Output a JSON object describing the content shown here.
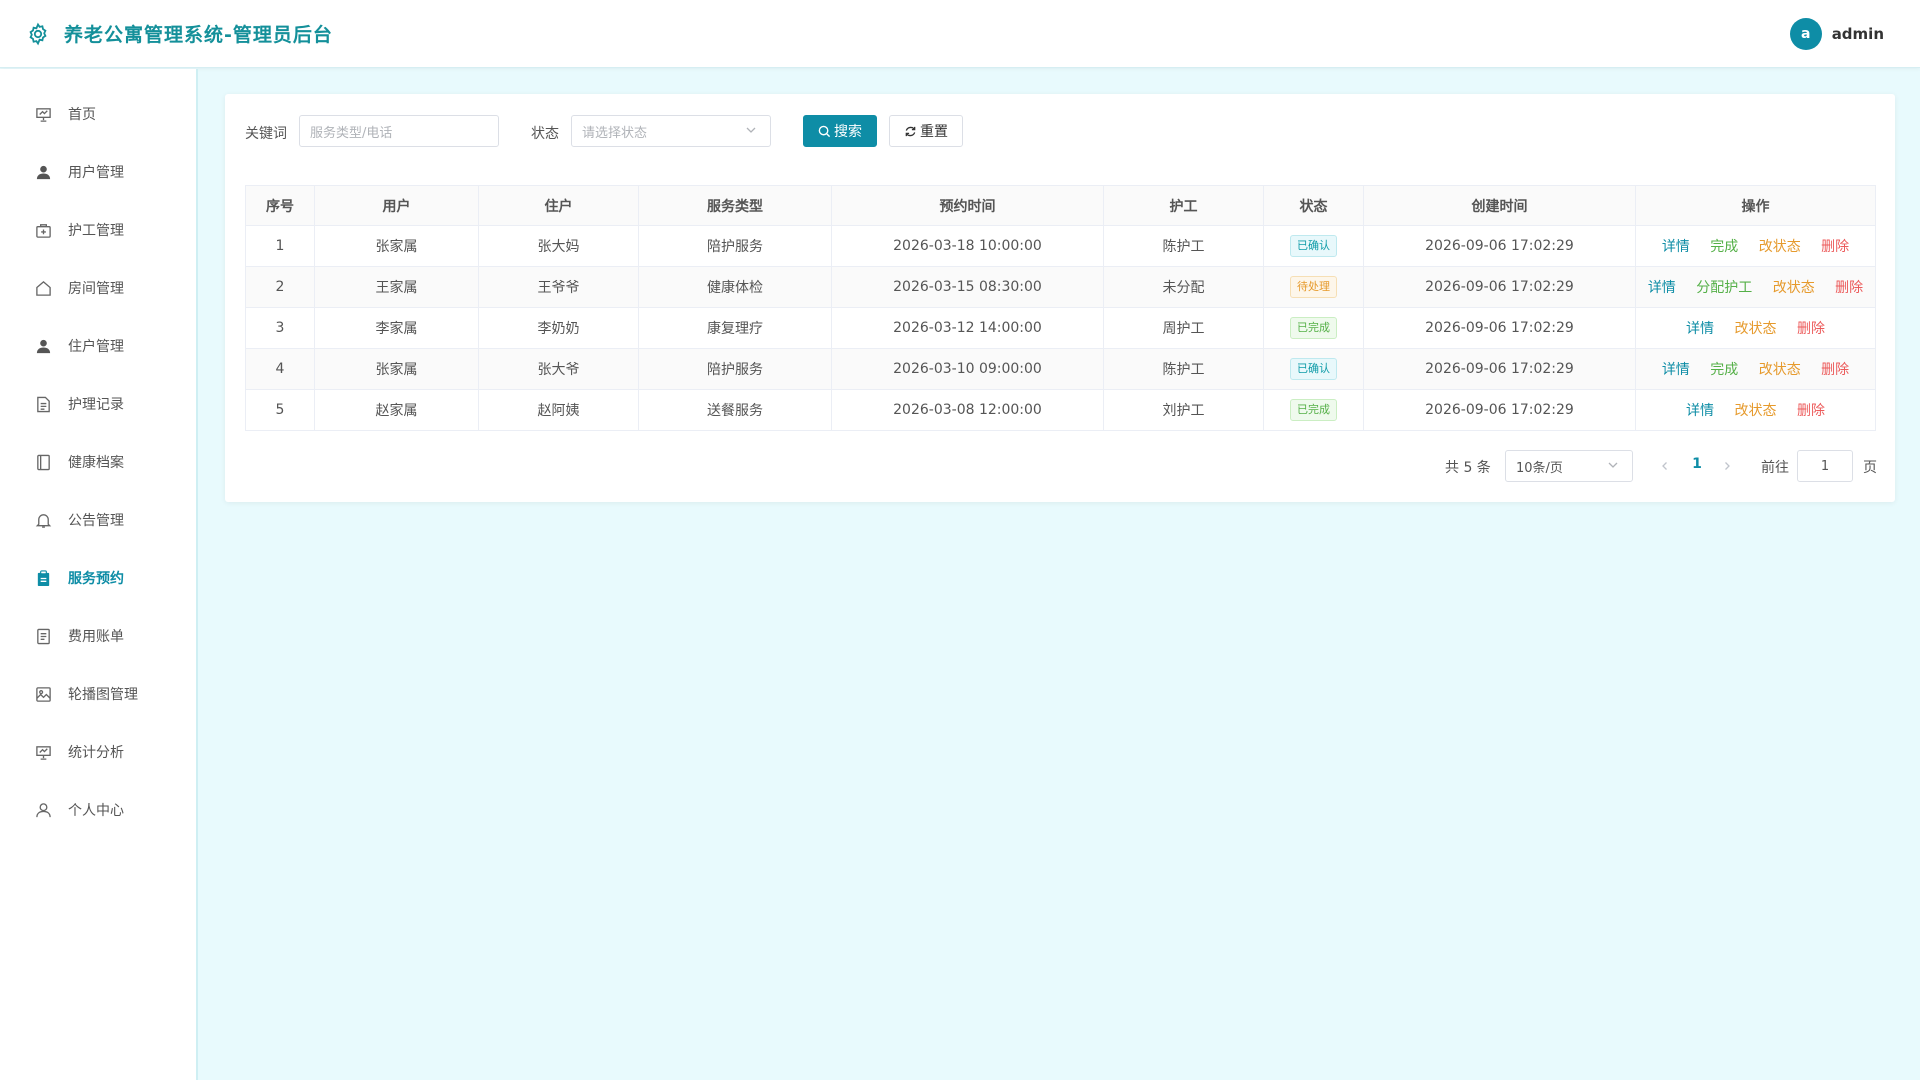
{
  "app": {
    "title": "养老公寓管理系统-管理员后台"
  },
  "user": {
    "avatar_letter": "a",
    "name": "admin"
  },
  "sidebar": {
    "items": [
      {
        "label": "首页",
        "icon": "presentation-icon",
        "active": false
      },
      {
        "label": "用户管理",
        "icon": "user-icon",
        "active": false
      },
      {
        "label": "护工管理",
        "icon": "first-aid-kit-icon",
        "active": false
      },
      {
        "label": "房间管理",
        "icon": "house-icon",
        "active": false
      },
      {
        "label": "住户管理",
        "icon": "user-icon",
        "active": false
      },
      {
        "label": "护理记录",
        "icon": "document-icon",
        "active": false
      },
      {
        "label": "健康档案",
        "icon": "notebook-icon",
        "active": false
      },
      {
        "label": "公告管理",
        "icon": "bell-icon",
        "active": false
      },
      {
        "label": "服务预约",
        "icon": "clipboard-icon",
        "active": true
      },
      {
        "label": "费用账单",
        "icon": "receipt-icon",
        "active": false
      },
      {
        "label": "轮播图管理",
        "icon": "picture-icon",
        "active": false
      },
      {
        "label": "统计分析",
        "icon": "data-board-icon",
        "active": false
      },
      {
        "label": "个人中心",
        "icon": "user-outline-icon",
        "active": false
      }
    ]
  },
  "filters": {
    "keyword_label": "关键词",
    "keyword_placeholder": "服务类型/电话",
    "status_label": "状态",
    "status_placeholder": "请选择状态",
    "search_label": "搜索",
    "reset_label": "重置"
  },
  "table": {
    "columns": [
      "序号",
      "用户",
      "住户",
      "服务类型",
      "预约时间",
      "护工",
      "状态",
      "创建时间",
      "操作"
    ],
    "rows": [
      {
        "index": "1",
        "user": "张家属",
        "resident": "张大妈",
        "service": "陪护服务",
        "appointment": "2026-03-18 10:00:00",
        "caregiver": "陈护工",
        "status": "已确认",
        "status_type": "confirm",
        "created": "2026-09-06 17:02:29",
        "actions": [
          "详情",
          "完成",
          "改状态",
          "删除"
        ]
      },
      {
        "index": "2",
        "user": "王家属",
        "resident": "王爷爷",
        "service": "健康体检",
        "appointment": "2026-03-15 08:30:00",
        "caregiver": "未分配",
        "status": "待处理",
        "status_type": "pending",
        "created": "2026-09-06 17:02:29",
        "actions": [
          "详情",
          "分配护工",
          "改状态",
          "删除"
        ]
      },
      {
        "index": "3",
        "user": "李家属",
        "resident": "李奶奶",
        "service": "康复理疗",
        "appointment": "2026-03-12 14:00:00",
        "caregiver": "周护工",
        "status": "已完成",
        "status_type": "done",
        "created": "2026-09-06 17:02:29",
        "actions": [
          "详情",
          "改状态",
          "删除"
        ]
      },
      {
        "index": "4",
        "user": "张家属",
        "resident": "张大爷",
        "service": "陪护服务",
        "appointment": "2026-03-10 09:00:00",
        "caregiver": "陈护工",
        "status": "已确认",
        "status_type": "confirm",
        "created": "2026-09-06 17:02:29",
        "actions": [
          "详情",
          "完成",
          "改状态",
          "删除"
        ]
      },
      {
        "index": "5",
        "user": "赵家属",
        "resident": "赵阿姨",
        "service": "送餐服务",
        "appointment": "2026-03-08 12:00:00",
        "caregiver": "刘护工",
        "status": "已完成",
        "status_type": "done",
        "created": "2026-09-06 17:02:29",
        "actions": [
          "详情",
          "改状态",
          "删除"
        ]
      }
    ]
  },
  "pagination": {
    "total_text": "共 5 条",
    "page_size": "10条/页",
    "current_page": "1",
    "goto_label": "前往",
    "goto_value": "1",
    "goto_unit": "页"
  },
  "colors": {
    "primary": "#0e8da6",
    "title": "#14909a",
    "background": "#e8fafd",
    "confirm": "#0e9ba8",
    "pending": "#e69a2c",
    "done": "#55b048",
    "danger": "#ec5b5b"
  }
}
